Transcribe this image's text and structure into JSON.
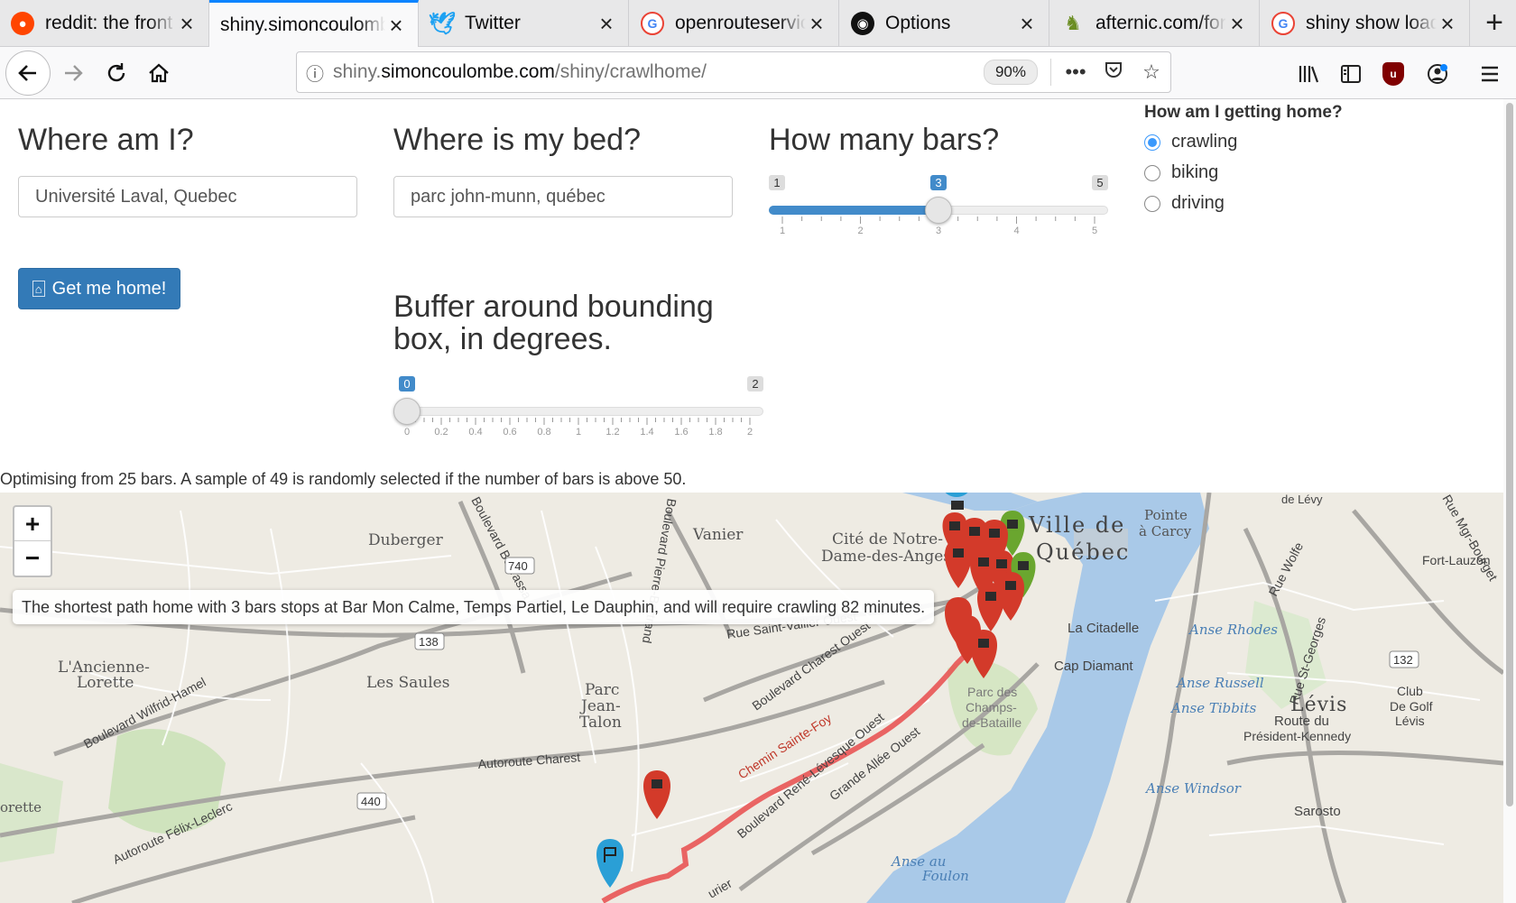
{
  "browser": {
    "tabs": [
      {
        "title": "reddit: the front page of the internet",
        "favicon": "reddit-icon"
      },
      {
        "title": "shiny.simoncoulombe.com",
        "favicon": "page-icon",
        "active": true
      },
      {
        "title": "Twitter",
        "favicon": "twitter-icon"
      },
      {
        "title": "openrouteservice",
        "favicon": "google-icon"
      },
      {
        "title": "Options",
        "favicon": "github-icon"
      },
      {
        "title": "afternic.com/forsale",
        "favicon": "afternic-icon"
      },
      {
        "title": "shiny show loading",
        "favicon": "google-icon"
      }
    ],
    "url_prefix": "shiny.",
    "url_host": "simoncoulombe.com",
    "url_path": "/shiny/crawlhome/",
    "zoom": "90%"
  },
  "form": {
    "where_label": "Where am I?",
    "where_value": "Université Laval, Quebec",
    "bed_label": "Where is my bed?",
    "bed_value": "parc john-munn, québec",
    "bars_label": "How many bars?",
    "bars_slider": {
      "min": 1,
      "max": 5,
      "value": 3,
      "ticks": [
        "1",
        "2",
        "3",
        "4",
        "5"
      ],
      "min_label": "1",
      "max_label": "5",
      "value_label": "3"
    },
    "buffer_label": "Buffer around bounding box, in degrees.",
    "buffer_slider": {
      "min": 0,
      "max": 2,
      "value": 0,
      "ticks": [
        "0",
        "0.2",
        "0.4",
        "0.6",
        "0.8",
        "1",
        "1.2",
        "1.4",
        "1.6",
        "1.8",
        "2"
      ],
      "min_label": "0",
      "max_label": "2",
      "value_label": "0"
    },
    "mode_label": "How am I getting home?",
    "modes": [
      {
        "label": "crawling",
        "selected": true
      },
      {
        "label": "biking",
        "selected": false
      },
      {
        "label": "driving",
        "selected": false
      }
    ],
    "submit_label": "Get me home!"
  },
  "status_text": "Optimising from 25 bars. A sample of 49 is randomly selected if the number of bars is above 50.",
  "map": {
    "zoom_in": "+",
    "zoom_out": "−",
    "message": "The shortest path home with 3 bars stops at Bar Mon Calme, Temps Partiel, Le Dauphin, and will require crawling 82 minutes.",
    "colors": {
      "water": "#a9c9e8",
      "land": "#eeebe3",
      "route": "#e74c4c",
      "bar_marker": "#d33a2a",
      "home_marker": "#2a9fd6",
      "green_marker": "#6aa62f"
    },
    "labels": {
      "duberger": "Duberger",
      "vanier": "Vanier",
      "cite": "Cité de Notre-",
      "cite2": "Dame-des-Anges",
      "ville": "Ville de",
      "ville2": "Québec",
      "pointe": "Pointe",
      "pointe2": "à Carcy",
      "ancienne": "L'Ancienne-",
      "lorette": "Lorette",
      "saules": "Les Saules",
      "parc1": "Parc",
      "parc2": "Jean-",
      "parc3": "Talon",
      "citadelle": "La Citadelle",
      "cap": "Cap Diamant",
      "champs1": "Parc des",
      "champs2": "Champs-",
      "champs3": "de-Bataille",
      "levis": "Lévis",
      "sarosto": "Sarosto",
      "fortlauzon": "Fort-Lauzon",
      "club1": "Club",
      "club2": "De Golf",
      "club3": "Lévis",
      "route_pres1": "Route du",
      "route_pres2": "Président-Kennedy",
      "anse_rhodes": "Anse Rhodes",
      "anse_russell": "Anse Russell",
      "anse_tibbits": "Anse Tibbits",
      "anse_windsor": "Anse Windsor",
      "anse_au": "Anse au",
      "foulon": "Foulon",
      "r_bourassa": "Boulevard Bourassa",
      "r_wilfrid": "Boulevard Wilfrid-Hamel",
      "r_charest": "Autoroute Charest",
      "r_charest_ouest": "Boulevard Charest Ouest",
      "r_sainte_foy": "Chemin Sainte-Foy",
      "r_rene": "Boulevard René-Lévesque Ouest",
      "r_grande": "Grande Allée Ouest",
      "r_felix": "Autoroute Félix-Leclerc",
      "r_saint": "Rue Saint-Vallier Ouest",
      "r_wolfe": "Rue Wolfe",
      "r_st_georges": "Rue St-Georges",
      "r_mgr": "Rue Mgr-Bourget",
      "r_national": "Boulevard Pierre-Bertrand",
      "s740": "740",
      "s138": "138",
      "s440": "440",
      "s132": "132",
      "orette": "orette",
      "de_levy": "de Lévy",
      "urier": "urier"
    }
  }
}
